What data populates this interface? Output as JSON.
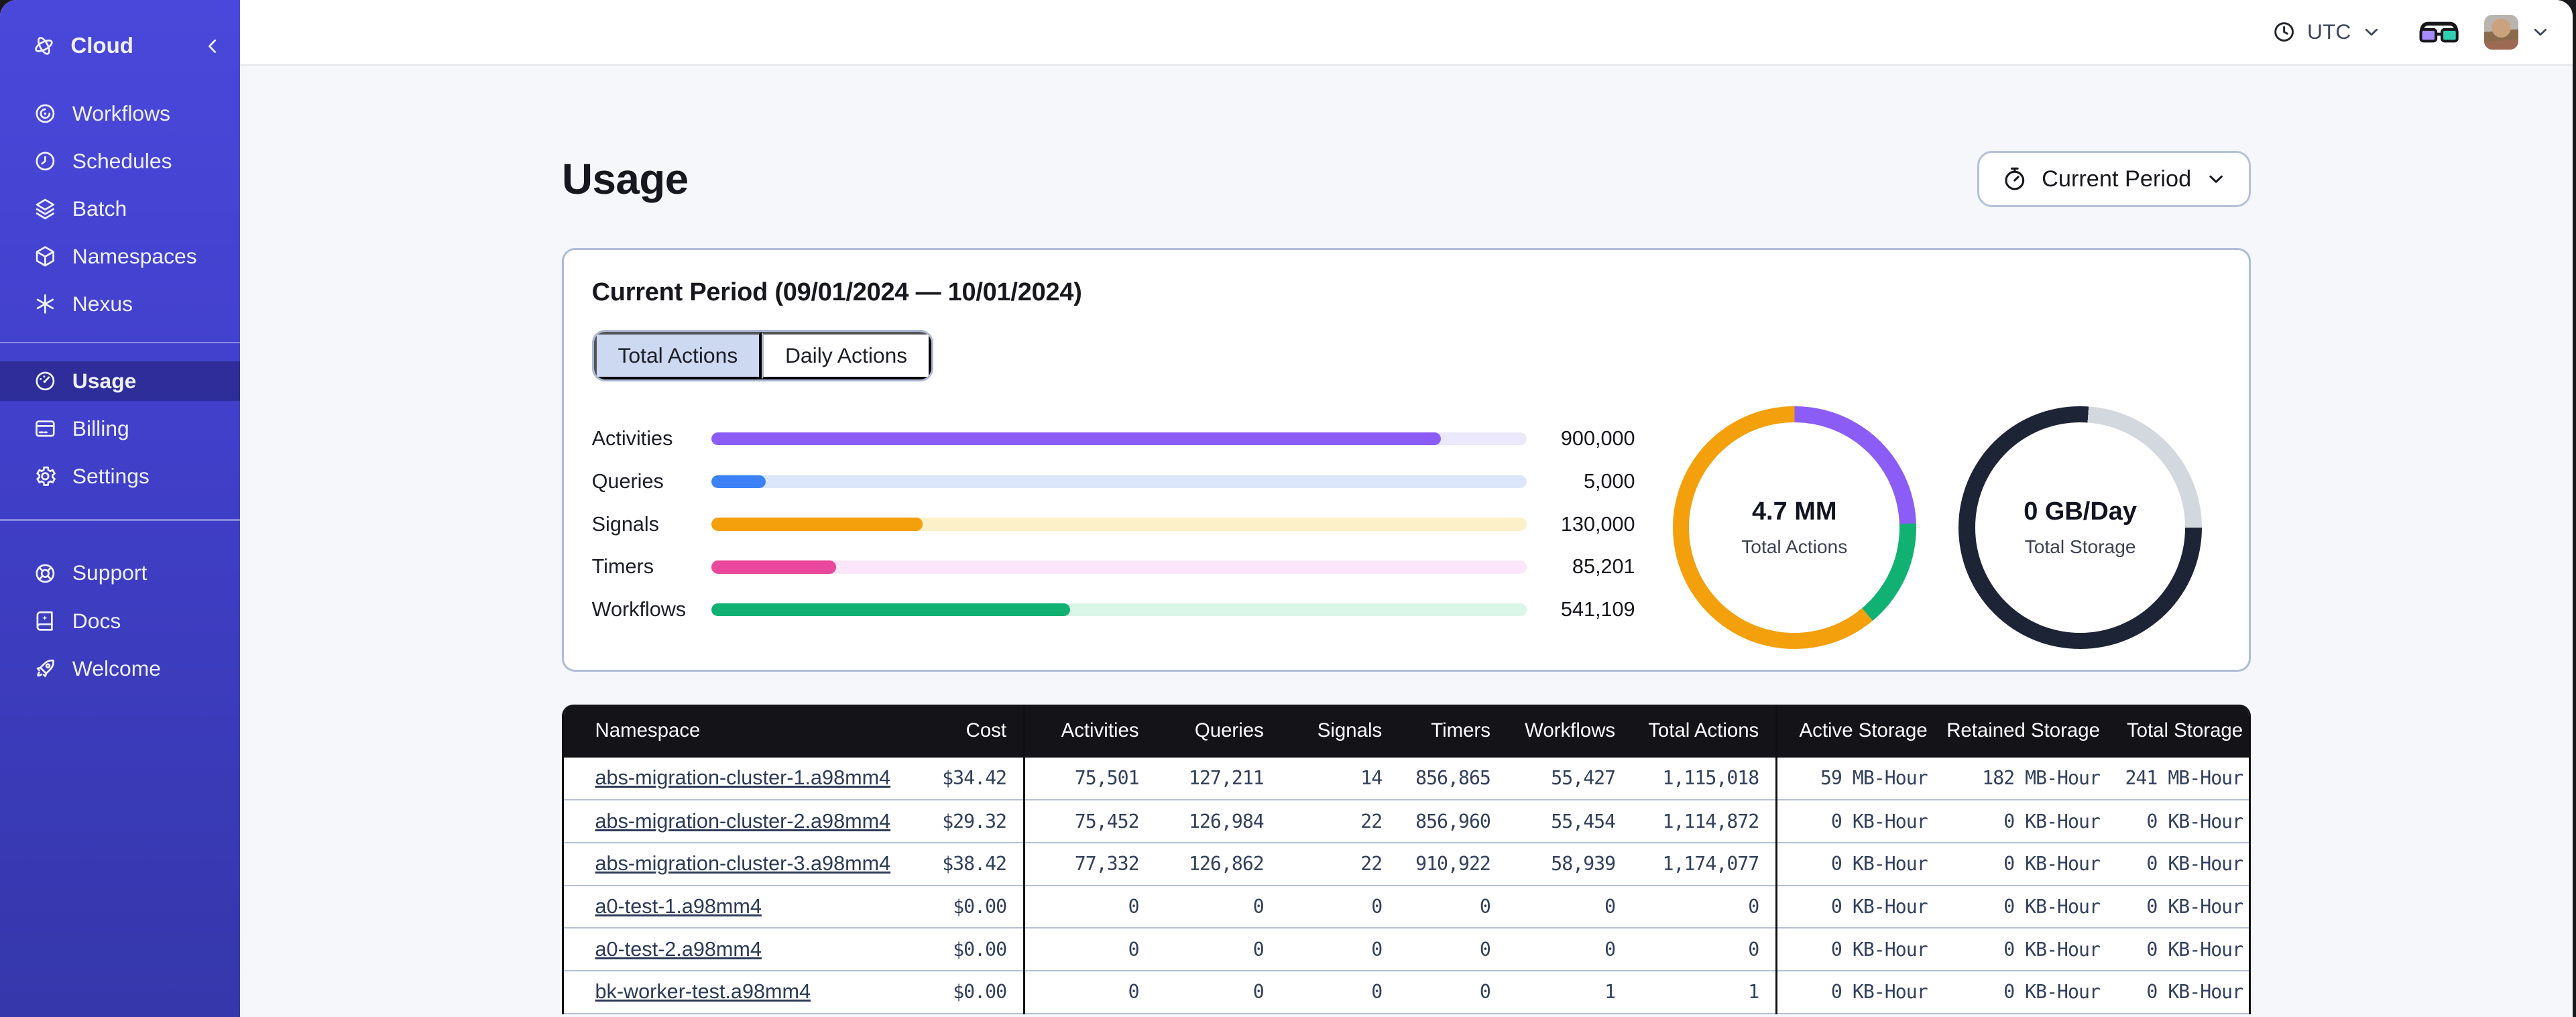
{
  "sidebar": {
    "brand": {
      "label": "Cloud",
      "icon": "temporal-logo",
      "collapse_icon": "chevron-left"
    },
    "groups": [
      {
        "items": [
          {
            "label": "Workflows",
            "icon": "workflows-icon",
            "selected": false
          },
          {
            "label": "Schedules",
            "icon": "schedules-icon",
            "selected": false
          },
          {
            "label": "Batch",
            "icon": "batch-icon",
            "selected": false
          },
          {
            "label": "Namespaces",
            "icon": "namespaces-icon",
            "selected": false
          },
          {
            "label": "Nexus",
            "icon": "nexus-icon",
            "selected": false
          }
        ]
      },
      {
        "items": [
          {
            "label": "Usage",
            "icon": "usage-icon",
            "selected": true
          },
          {
            "label": "Billing",
            "icon": "billing-icon",
            "selected": false
          },
          {
            "label": "Settings",
            "icon": "settings-icon",
            "selected": false
          }
        ]
      },
      {
        "items": [
          {
            "label": "Support",
            "icon": "support-icon",
            "selected": false
          },
          {
            "label": "Docs",
            "icon": "docs-icon",
            "selected": false
          },
          {
            "label": "Welcome",
            "icon": "welcome-icon",
            "selected": false
          }
        ]
      }
    ]
  },
  "topbar": {
    "timezone_label": "UTC",
    "timezone_icon": "clock-icon",
    "glasses_icon": "glasses-icon",
    "avatar": "user-avatar",
    "avatar_menu_icon": "chevron-down-icon"
  },
  "page": {
    "title": "Usage",
    "period_button_label": "Current Period",
    "period_button_icon": "stopwatch-icon"
  },
  "usage_card": {
    "title": "Current Period (09/01/2024 — 10/01/2024)",
    "tabs": [
      {
        "label": "Total Actions",
        "selected": true
      },
      {
        "label": "Daily Actions",
        "selected": false
      }
    ]
  },
  "chart_data": [
    {
      "type": "bar",
      "title": "Total Actions by action type",
      "orientation": "horizontal",
      "categories": [
        "Activities",
        "Queries",
        "Signals",
        "Timers",
        "Workflows"
      ],
      "values": [
        900000,
        5000,
        130000,
        85201,
        541109
      ],
      "value_labels": [
        "900,000",
        "5,000",
        "130,000",
        "85,201",
        "541,109"
      ],
      "bar_colors": [
        "#8b5cf6",
        "#3c82f6",
        "#f3a00c",
        "#e9489c",
        "#10b173"
      ],
      "track_colors": [
        "#ece8fb",
        "#dbe6fb",
        "#fcf0c9",
        "#fbe7f9",
        "#d9f6e9"
      ],
      "bar_fill_pct": [
        89.5,
        6.6,
        25.9,
        15.3,
        44.0
      ],
      "grid": false,
      "legend": false
    },
    {
      "type": "pie",
      "style": "donut",
      "center_value": "4.7 MM",
      "center_label": "Total Actions",
      "segments": [
        {
          "name": "activities",
          "color": "#8b5cf6",
          "start_deg": 0,
          "end_deg": 88
        },
        {
          "name": "workflows",
          "color": "#10b173",
          "start_deg": 88,
          "end_deg": 140
        },
        {
          "name": "signals",
          "color": "#f3a00c",
          "start_deg": 140,
          "end_deg": 360
        }
      ]
    },
    {
      "type": "pie",
      "style": "donut",
      "center_value": "0 GB/Day",
      "center_label": "Total Storage",
      "segments": [
        {
          "name": "filled",
          "color": "#1c2435",
          "start_deg": 0,
          "end_deg": 4
        },
        {
          "name": "empty",
          "color": "#d3d7de",
          "start_deg": 4,
          "end_deg": 90
        },
        {
          "name": "filled",
          "color": "#1c2435",
          "start_deg": 90,
          "end_deg": 360
        }
      ]
    }
  ],
  "table": {
    "columns": [
      {
        "key": "namespace",
        "label": "Namespace"
      },
      {
        "key": "cost",
        "label": "Cost"
      },
      {
        "key": "activities",
        "label": "Activities"
      },
      {
        "key": "queries",
        "label": "Queries"
      },
      {
        "key": "signals",
        "label": "Signals"
      },
      {
        "key": "timers",
        "label": "Timers"
      },
      {
        "key": "workflows",
        "label": "Workflows"
      },
      {
        "key": "total_actions",
        "label": "Total Actions"
      },
      {
        "key": "active_storage",
        "label": "Active Storage"
      },
      {
        "key": "retained_storage",
        "label": "Retained Storage"
      },
      {
        "key": "total_storage",
        "label": "Total Storage"
      }
    ],
    "rows": [
      {
        "namespace": "abs-migration-cluster-1.a98mm4",
        "cost": "$34.42",
        "activities": "75,501",
        "queries": "127,211",
        "signals": "14",
        "timers": "856,865",
        "workflows": "55,427",
        "total_actions": "1,115,018",
        "active_storage": "59 MB-Hour",
        "retained_storage": "182 MB-Hour",
        "total_storage": "241 MB-Hour"
      },
      {
        "namespace": "abs-migration-cluster-2.a98mm4",
        "cost": "$29.32",
        "activities": "75,452",
        "queries": "126,984",
        "signals": "22",
        "timers": "856,960",
        "workflows": "55,454",
        "total_actions": "1,114,872",
        "active_storage": "0 KB-Hour",
        "retained_storage": "0 KB-Hour",
        "total_storage": "0 KB-Hour"
      },
      {
        "namespace": "abs-migration-cluster-3.a98mm4",
        "cost": "$38.42",
        "activities": "77,332",
        "queries": "126,862",
        "signals": "22",
        "timers": "910,922",
        "workflows": "58,939",
        "total_actions": "1,174,077",
        "active_storage": "0 KB-Hour",
        "retained_storage": "0 KB-Hour",
        "total_storage": "0 KB-Hour"
      },
      {
        "namespace": "a0-test-1.a98mm4",
        "cost": "$0.00",
        "activities": "0",
        "queries": "0",
        "signals": "0",
        "timers": "0",
        "workflows": "0",
        "total_actions": "0",
        "active_storage": "0 KB-Hour",
        "retained_storage": "0 KB-Hour",
        "total_storage": "0 KB-Hour"
      },
      {
        "namespace": "a0-test-2.a98mm4",
        "cost": "$0.00",
        "activities": "0",
        "queries": "0",
        "signals": "0",
        "timers": "0",
        "workflows": "0",
        "total_actions": "0",
        "active_storage": "0 KB-Hour",
        "retained_storage": "0 KB-Hour",
        "total_storage": "0 KB-Hour"
      },
      {
        "namespace": "bk-worker-test.a98mm4",
        "cost": "$0.00",
        "activities": "0",
        "queries": "0",
        "signals": "0",
        "timers": "0",
        "workflows": "1",
        "total_actions": "1",
        "active_storage": "0 KB-Hour",
        "retained_storage": "0 KB-Hour",
        "total_storage": "0 KB-Hour"
      }
    ]
  },
  "colors": {
    "sidebar_top": "#4a48da",
    "sidebar_bottom": "#3537aa",
    "sidebar_selected": "rgba(10,8,60,0.34)",
    "main_bg": "#f6f7fa",
    "card_border": "#aebcd8",
    "tab_selected_bg": "#cdd8f1",
    "table_header_bg": "#131318",
    "table_divider": "#b6c0d6",
    "glasses_left_lens": "#a78bfa",
    "glasses_right_lens": "#2fd0b2"
  }
}
